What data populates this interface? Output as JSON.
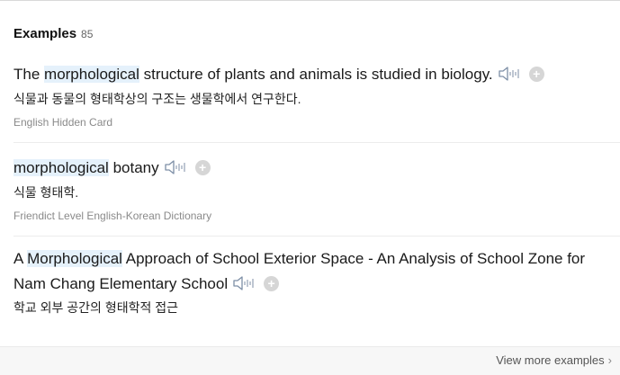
{
  "header": {
    "title": "Examples",
    "count": "85"
  },
  "examples": [
    {
      "pre": "The ",
      "highlight": "morphological",
      "post": " structure of plants and animals is studied in biology.",
      "translation": "식물과 동물의 형태학상의 구조는 생물학에서 연구한다.",
      "source": "English Hidden Card"
    },
    {
      "pre": "",
      "highlight": "morphological",
      "post": " botany",
      "translation": "식물 형태학.",
      "source": "Friendict Level English-Korean Dictionary"
    },
    {
      "pre": "A ",
      "highlight": "Morphological",
      "post": " Approach of School Exterior Space - An Analysis of School Zone for Nam Chang Elementary School",
      "translation": "학교 외부 공간의 형태학적 접근",
      "source": ""
    }
  ],
  "footer": {
    "view_more": "View more examples",
    "chevron": "›"
  },
  "icons": {
    "speaker": "speaker-icon",
    "add": "add-icon"
  },
  "colors": {
    "highlight": "#e5f1fb",
    "add_button": "#d6d6d6"
  }
}
